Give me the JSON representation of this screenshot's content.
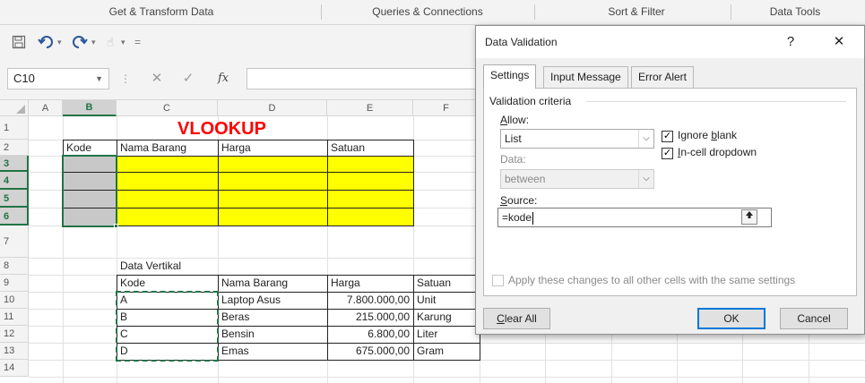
{
  "ribbon": {
    "groups": [
      "Get & Transform Data",
      "Queries & Connections",
      "Sort & Filter",
      "Data Tools"
    ]
  },
  "qat": {
    "save_icon": "save-icon",
    "undo_icon": "undo-icon",
    "redo_icon": "redo-icon",
    "customize_icon": "customize-qat-icon"
  },
  "formula_bar": {
    "name_box": "C10",
    "fx": "fx",
    "formula": ""
  },
  "sheet": {
    "columns": [
      "A",
      "B",
      "C",
      "D",
      "E",
      "F"
    ],
    "selected_column": "B",
    "rows": [
      "1",
      "2",
      "3",
      "4",
      "5",
      "6",
      "7",
      "8",
      "9",
      "10",
      "11",
      "12",
      "13",
      "14"
    ],
    "title": "VLOOKUP",
    "top_table": {
      "headers": [
        "Kode",
        "Nama Barang",
        "Harga",
        "Satuan"
      ]
    },
    "data_label": "Data Vertikal",
    "bottom_table": {
      "headers": [
        "Kode",
        "Nama Barang",
        "Harga",
        "Satuan"
      ],
      "rows": [
        [
          "A",
          "Laptop Asus",
          "7.800.000,00",
          "Unit"
        ],
        [
          "B",
          "Beras",
          "215.000,00",
          "Karung"
        ],
        [
          "C",
          "Bensin",
          "6.800,00",
          "Liter"
        ],
        [
          "D",
          "Emas",
          "675.000,00",
          "Gram"
        ]
      ]
    },
    "colors": {
      "highlight": "#ffff00",
      "title": "#ff0000",
      "selection": "#217346"
    }
  },
  "dialog": {
    "title": "Data Validation",
    "help": "?",
    "close": "✕",
    "tabs": [
      "Settings",
      "Input Message",
      "Error Alert"
    ],
    "active_tab": "Settings",
    "criteria_label": "Validation criteria",
    "allow_label": "Allow:",
    "allow_value": "List",
    "data_label": "Data:",
    "data_value": "between",
    "ignore_blank": "Ignore blank",
    "ignore_blank_checked": true,
    "in_cell_dropdown": "In-cell dropdown",
    "in_cell_dropdown_checked": true,
    "source_label": "Source:",
    "source_value": "=kode",
    "apply_all": "Apply these changes to all other cells with the same settings",
    "apply_all_checked": false,
    "clear_all": "Clear All",
    "ok": "OK",
    "cancel": "Cancel"
  }
}
